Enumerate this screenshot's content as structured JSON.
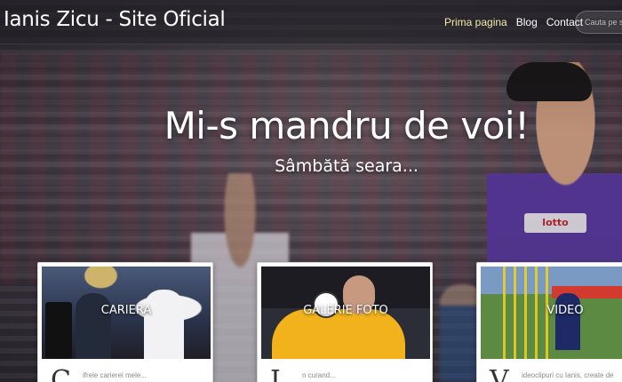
{
  "site": {
    "brand": "Ianis Zicu - Site Oficial"
  },
  "nav": {
    "items": [
      {
        "label": "Prima pagina",
        "active": true
      },
      {
        "label": "Blog",
        "active": false
      },
      {
        "label": "Contact",
        "active": false
      }
    ],
    "search_placeholder": "Cauta pe site"
  },
  "hero": {
    "headline": "Mi-s mandru de voi!",
    "subline": "Sâmbătă seara..."
  },
  "cards": [
    {
      "thumb_label": "CARIERA",
      "initial": "C",
      "excerpt": "ifrele carierei mele..."
    },
    {
      "thumb_label": "GALERIE FOTO",
      "initial": "I",
      "excerpt": "n curand..."
    },
    {
      "thumb_label": "VIDEO",
      "initial": "V",
      "excerpt": "ideoclipuri cu Ianis, create de"
    }
  ],
  "colors": {
    "nav_active": "#f2ecae",
    "text": "#ffffff",
    "jersey": "#5b3ba0"
  }
}
